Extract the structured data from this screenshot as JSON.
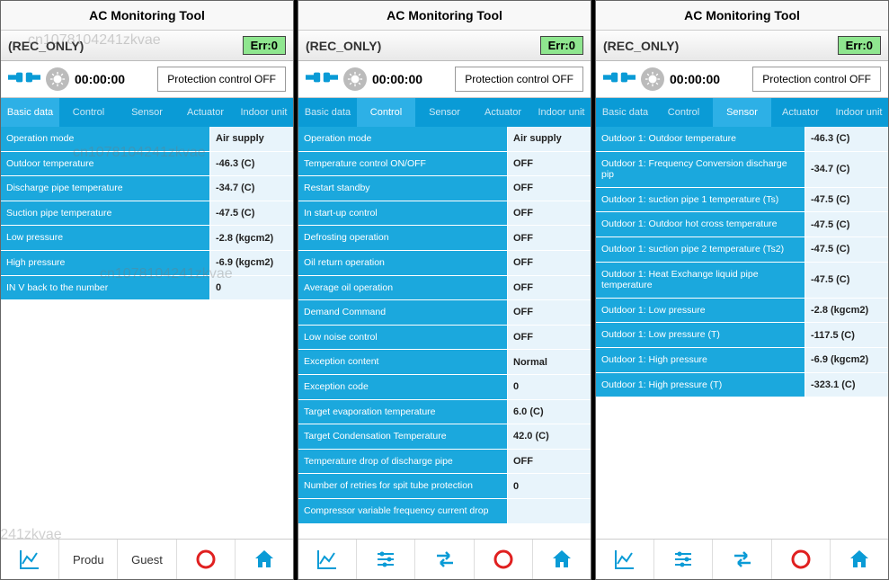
{
  "app_title": "AC Monitoring Tool",
  "status": {
    "label": "(REC_ONLY)",
    "err": "Err:0"
  },
  "control": {
    "timer": "00:00:00",
    "protect": "Protection control OFF"
  },
  "tabs": [
    "Basic data",
    "Control",
    "Sensor",
    "Actuator",
    "Indoor unit"
  ],
  "bottom": {
    "product": "Produ",
    "guest": "Guest"
  },
  "watermark": "cn1078104241zkvae",
  "screens": [
    {
      "active_tab": 0,
      "rows": [
        {
          "label": "Operation mode",
          "value": "Air supply"
        },
        {
          "label": "Outdoor temperature",
          "value": "-46.3 (C)"
        },
        {
          "label": "Discharge pipe temperature",
          "value": "-34.7 (C)"
        },
        {
          "label": "Suction pipe temperature",
          "value": "-47.5 (C)"
        },
        {
          "label": "Low pressure",
          "value": "-2.8 (kgcm2)"
        },
        {
          "label": "High pressure",
          "value": "-6.9 (kgcm2)"
        },
        {
          "label": "IN V back to the number",
          "value": "0"
        }
      ],
      "nav_style": "text"
    },
    {
      "active_tab": 1,
      "rows": [
        {
          "label": "Operation mode",
          "value": "Air supply"
        },
        {
          "label": "Temperature control ON/OFF",
          "value": "OFF"
        },
        {
          "label": "Restart standby",
          "value": "OFF"
        },
        {
          "label": "In start-up control",
          "value": "OFF"
        },
        {
          "label": "Defrosting operation",
          "value": "OFF"
        },
        {
          "label": "Oil return operation",
          "value": "OFF"
        },
        {
          "label": "Average oil operation",
          "value": "OFF"
        },
        {
          "label": "Demand Command",
          "value": "OFF"
        },
        {
          "label": "Low noise control",
          "value": "OFF"
        },
        {
          "label": "Exception content",
          "value": "Normal"
        },
        {
          "label": "Exception code",
          "value": "0"
        },
        {
          "label": "Target evaporation temperature",
          "value": "6.0 (C)"
        },
        {
          "label": "Target Condensation Temperature",
          "value": "42.0 (C)"
        },
        {
          "label": "Temperature drop of discharge pipe",
          "value": "OFF"
        },
        {
          "label": "Number of retries for spit tube protection",
          "value": "0"
        },
        {
          "label": "Compressor variable frequency current drop",
          "value": ""
        }
      ],
      "nav_style": "icons"
    },
    {
      "active_tab": 2,
      "rows": [
        {
          "label": "Outdoor 1: Outdoor temperature",
          "value": "-46.3 (C)"
        },
        {
          "label": "Outdoor 1: Frequency Conversion discharge pip",
          "value": "-34.7 (C)"
        },
        {
          "label": "Outdoor 1: suction pipe 1 temperature (Ts)",
          "value": "-47.5 (C)"
        },
        {
          "label": "Outdoor 1: Outdoor hot cross temperature",
          "value": "-47.5 (C)"
        },
        {
          "label": "Outdoor 1: suction pipe 2 temperature (Ts2)",
          "value": "-47.5 (C)"
        },
        {
          "label": "Outdoor 1: Heat Exchange liquid pipe temperature",
          "value": "-47.5 (C)"
        },
        {
          "label": "Outdoor 1: Low pressure",
          "value": "-2.8 (kgcm2)"
        },
        {
          "label": "Outdoor 1: Low pressure (T)",
          "value": "-117.5 (C)"
        },
        {
          "label": "Outdoor 1: High pressure",
          "value": "-6.9 (kgcm2)"
        },
        {
          "label": "Outdoor 1: High pressure (T)",
          "value": "-323.1 (C)"
        }
      ],
      "nav_style": "icons"
    }
  ]
}
